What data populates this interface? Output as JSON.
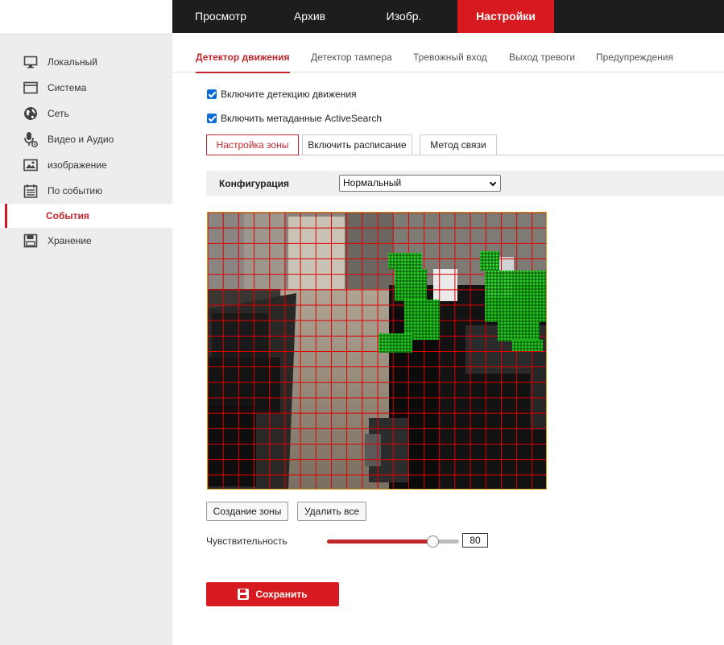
{
  "topnav": {
    "items": [
      {
        "label": "Просмотр",
        "active": false
      },
      {
        "label": "Архив",
        "active": false
      },
      {
        "label": "Изобр.",
        "active": false
      },
      {
        "label": "Настройки",
        "active": true
      }
    ]
  },
  "sidebar": {
    "items": [
      {
        "label": "Локальный",
        "icon": "monitor-icon"
      },
      {
        "label": "Система",
        "icon": "window-icon"
      },
      {
        "label": "Сеть",
        "icon": "globe-icon"
      },
      {
        "label": "Видео и Аудио",
        "icon": "microphone-icon"
      },
      {
        "label": "изображение",
        "icon": "image-icon"
      },
      {
        "label": "По событию",
        "icon": "calendar-icon"
      },
      {
        "label": "События",
        "icon": "",
        "active": true
      },
      {
        "label": "Хранение",
        "icon": "floppy-disk-icon"
      }
    ]
  },
  "tabs": [
    {
      "label": "Детектор движения",
      "active": true
    },
    {
      "label": "Детектор тампера",
      "active": false
    },
    {
      "label": "Тревожный вход",
      "active": false
    },
    {
      "label": "Выход тревоги",
      "active": false
    },
    {
      "label": "Предупреждения",
      "active": false
    }
  ],
  "options": {
    "enable_motion": {
      "label": "Включите детекцию движения",
      "checked": true
    },
    "enable_metadata": {
      "label": "Включить метаданные ActiveSearch",
      "checked": true
    }
  },
  "subtabs": [
    {
      "label": "Настройка зоны",
      "active": true
    },
    {
      "label": "Включить расписание",
      "active": false
    },
    {
      "label": "Метод связи",
      "active": false
    }
  ],
  "config": {
    "label": "Конфигурация",
    "value": "Нормальный"
  },
  "zone_buttons": {
    "create": "Создание зоны",
    "delete_all": "Удалить все"
  },
  "sensitivity": {
    "label": "Чувствительность",
    "value": "80",
    "percent": 80
  },
  "save_label": "Сохранить",
  "colors": {
    "accent": "#d71920",
    "grid": "#e00000",
    "motion": "#22dd22"
  }
}
